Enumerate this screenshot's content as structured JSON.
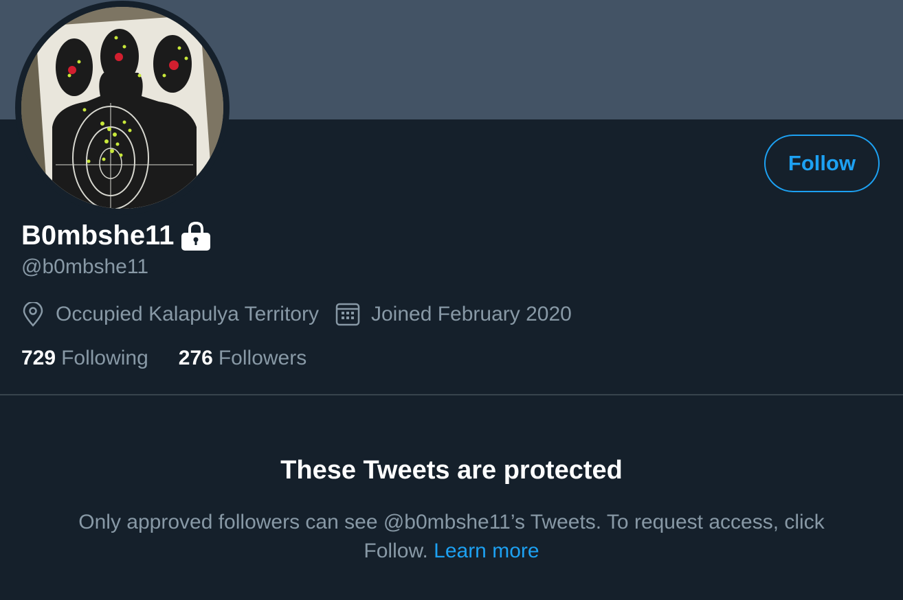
{
  "profile": {
    "display_name": "B0mbshe11",
    "handle": "@b0mbshe11",
    "location": "Occupied Kalapulya Territory",
    "joined": "Joined February 2020",
    "is_protected": true,
    "icons": {
      "lock": "lock-icon",
      "location": "location-pin-icon",
      "calendar": "calendar-icon"
    }
  },
  "actions": {
    "follow_label": "Follow"
  },
  "stats": {
    "following_count": "729",
    "following_label": "Following",
    "followers_count": "276",
    "followers_label": "Followers"
  },
  "protected_notice": {
    "title": "These Tweets are protected",
    "description": "Only approved followers can see @b0mbshe11’s Tweets. To request access, click Follow.",
    "link_label": "Learn more"
  },
  "colors": {
    "background": "#15202b",
    "banner": "#435365",
    "accent": "#1da1f2",
    "secondary_text": "#8899a6",
    "divider": "#38444d"
  }
}
